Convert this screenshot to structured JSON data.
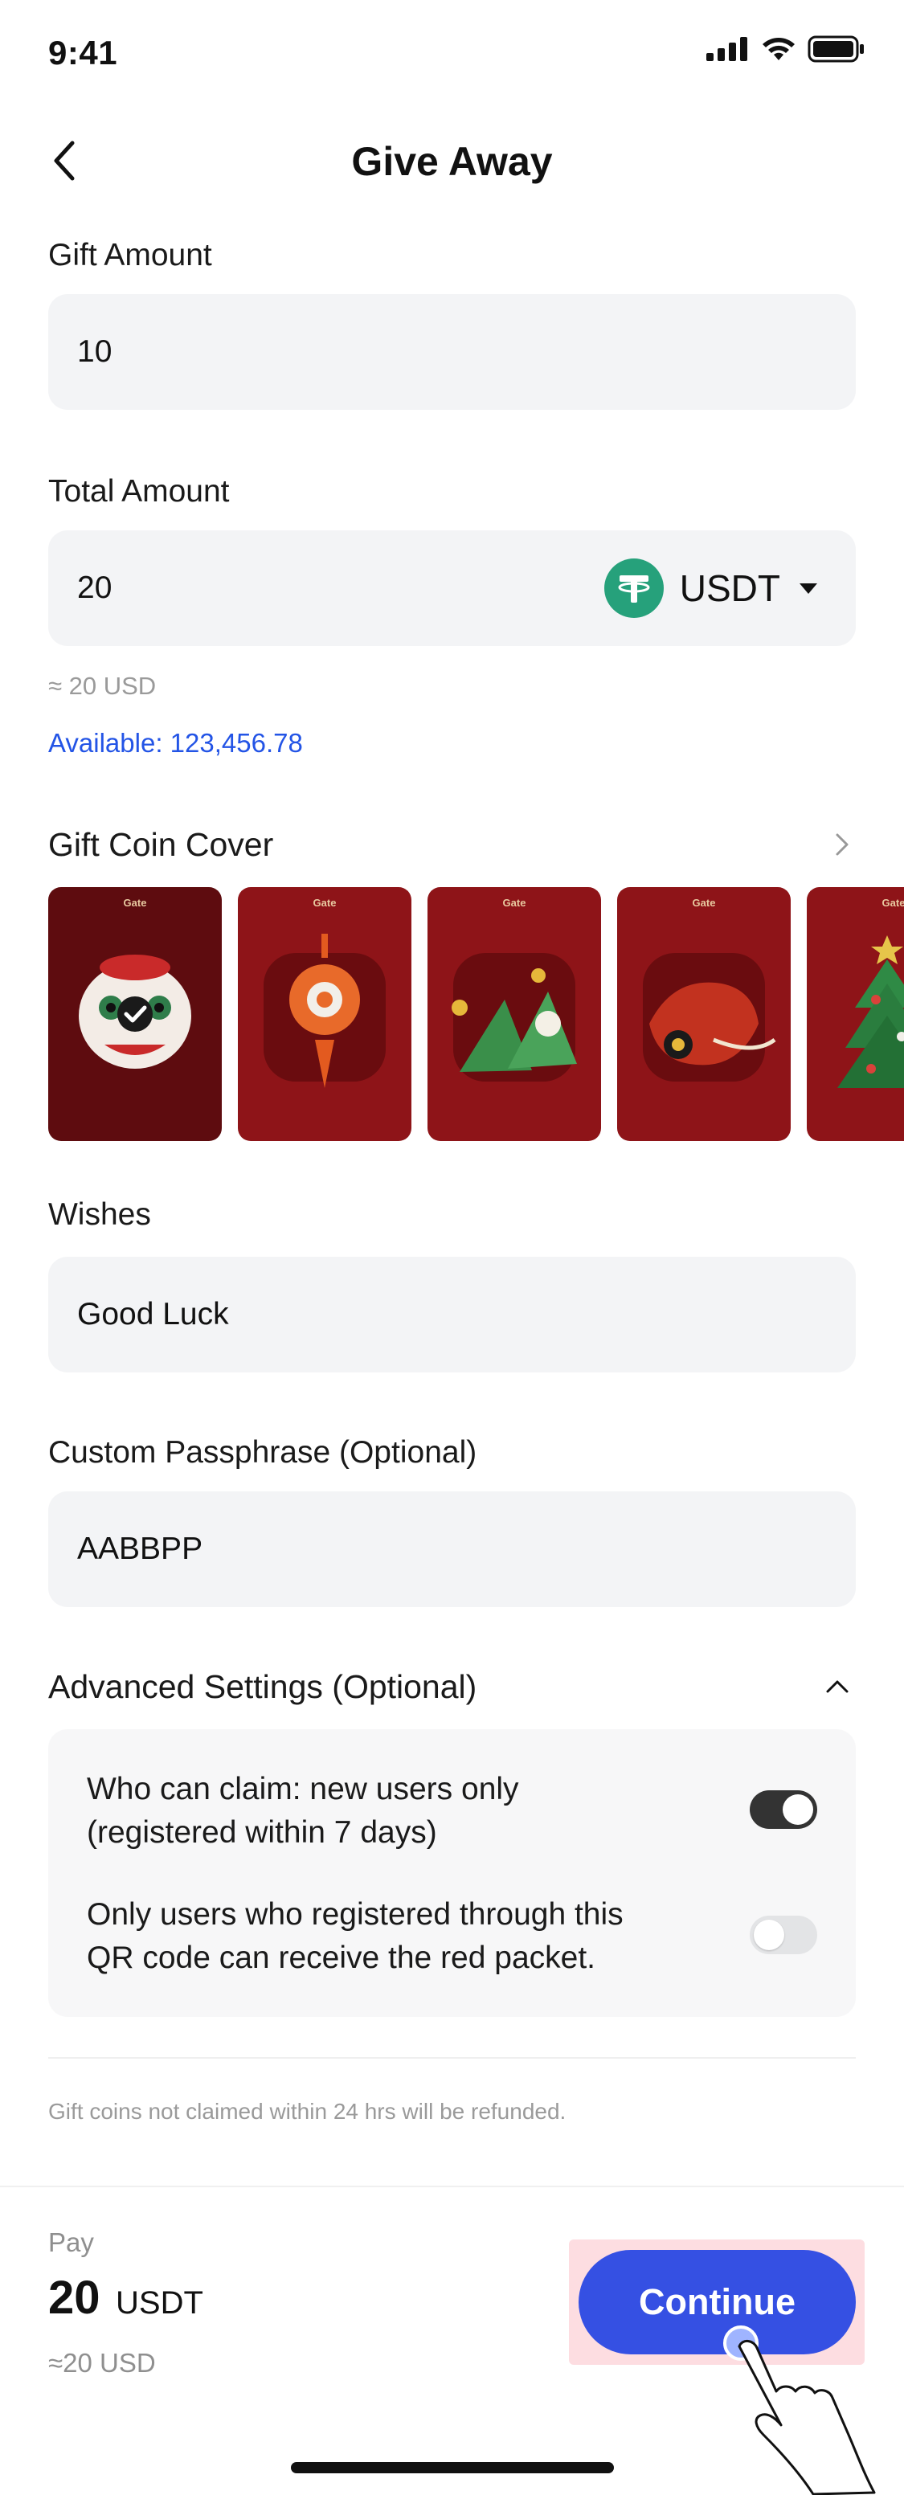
{
  "status": {
    "time": "9:41"
  },
  "nav": {
    "title": "Give Away"
  },
  "gift_amount": {
    "label": "Gift Amount",
    "value": "10"
  },
  "total_amount": {
    "label": "Total Amount",
    "value": "20",
    "coin": "USDT",
    "approx": "≈ 20 USD",
    "available": "Available: 123,456.78"
  },
  "covers": {
    "title": "Gift Coin Cover",
    "brand": "Gate",
    "items": [
      {
        "name": "lion-dance",
        "selected": true
      },
      {
        "name": "chinese-knot",
        "selected": false
      },
      {
        "name": "rice-dumplings",
        "selected": false
      },
      {
        "name": "dragon",
        "selected": false
      },
      {
        "name": "christmas-tree",
        "selected": false
      }
    ]
  },
  "wishes": {
    "label": "Wishes",
    "value": "Good Luck"
  },
  "passphrase": {
    "label": "Custom Passphrase (Optional)",
    "value": "AABBPP"
  },
  "advanced": {
    "title": "Advanced Settings (Optional)",
    "items": [
      {
        "line1": "Who can claim: new users only",
        "line2": "(registered within 7 days)",
        "enabled": true
      },
      {
        "line1": "Only users who registered through this",
        "line2": "QR code can receive the red packet.",
        "enabled": false
      }
    ]
  },
  "footnote": "Gift coins not claimed within 24 hrs will be refunded.",
  "pay": {
    "label": "Pay",
    "amount": "20",
    "unit": "USDT",
    "approx": "≈20 USD"
  },
  "continue_label": "Continue",
  "colors": {
    "accent": "#3550e3",
    "link": "#2354e6",
    "tether": "#26a17b",
    "cover_red": "#8e1418"
  }
}
